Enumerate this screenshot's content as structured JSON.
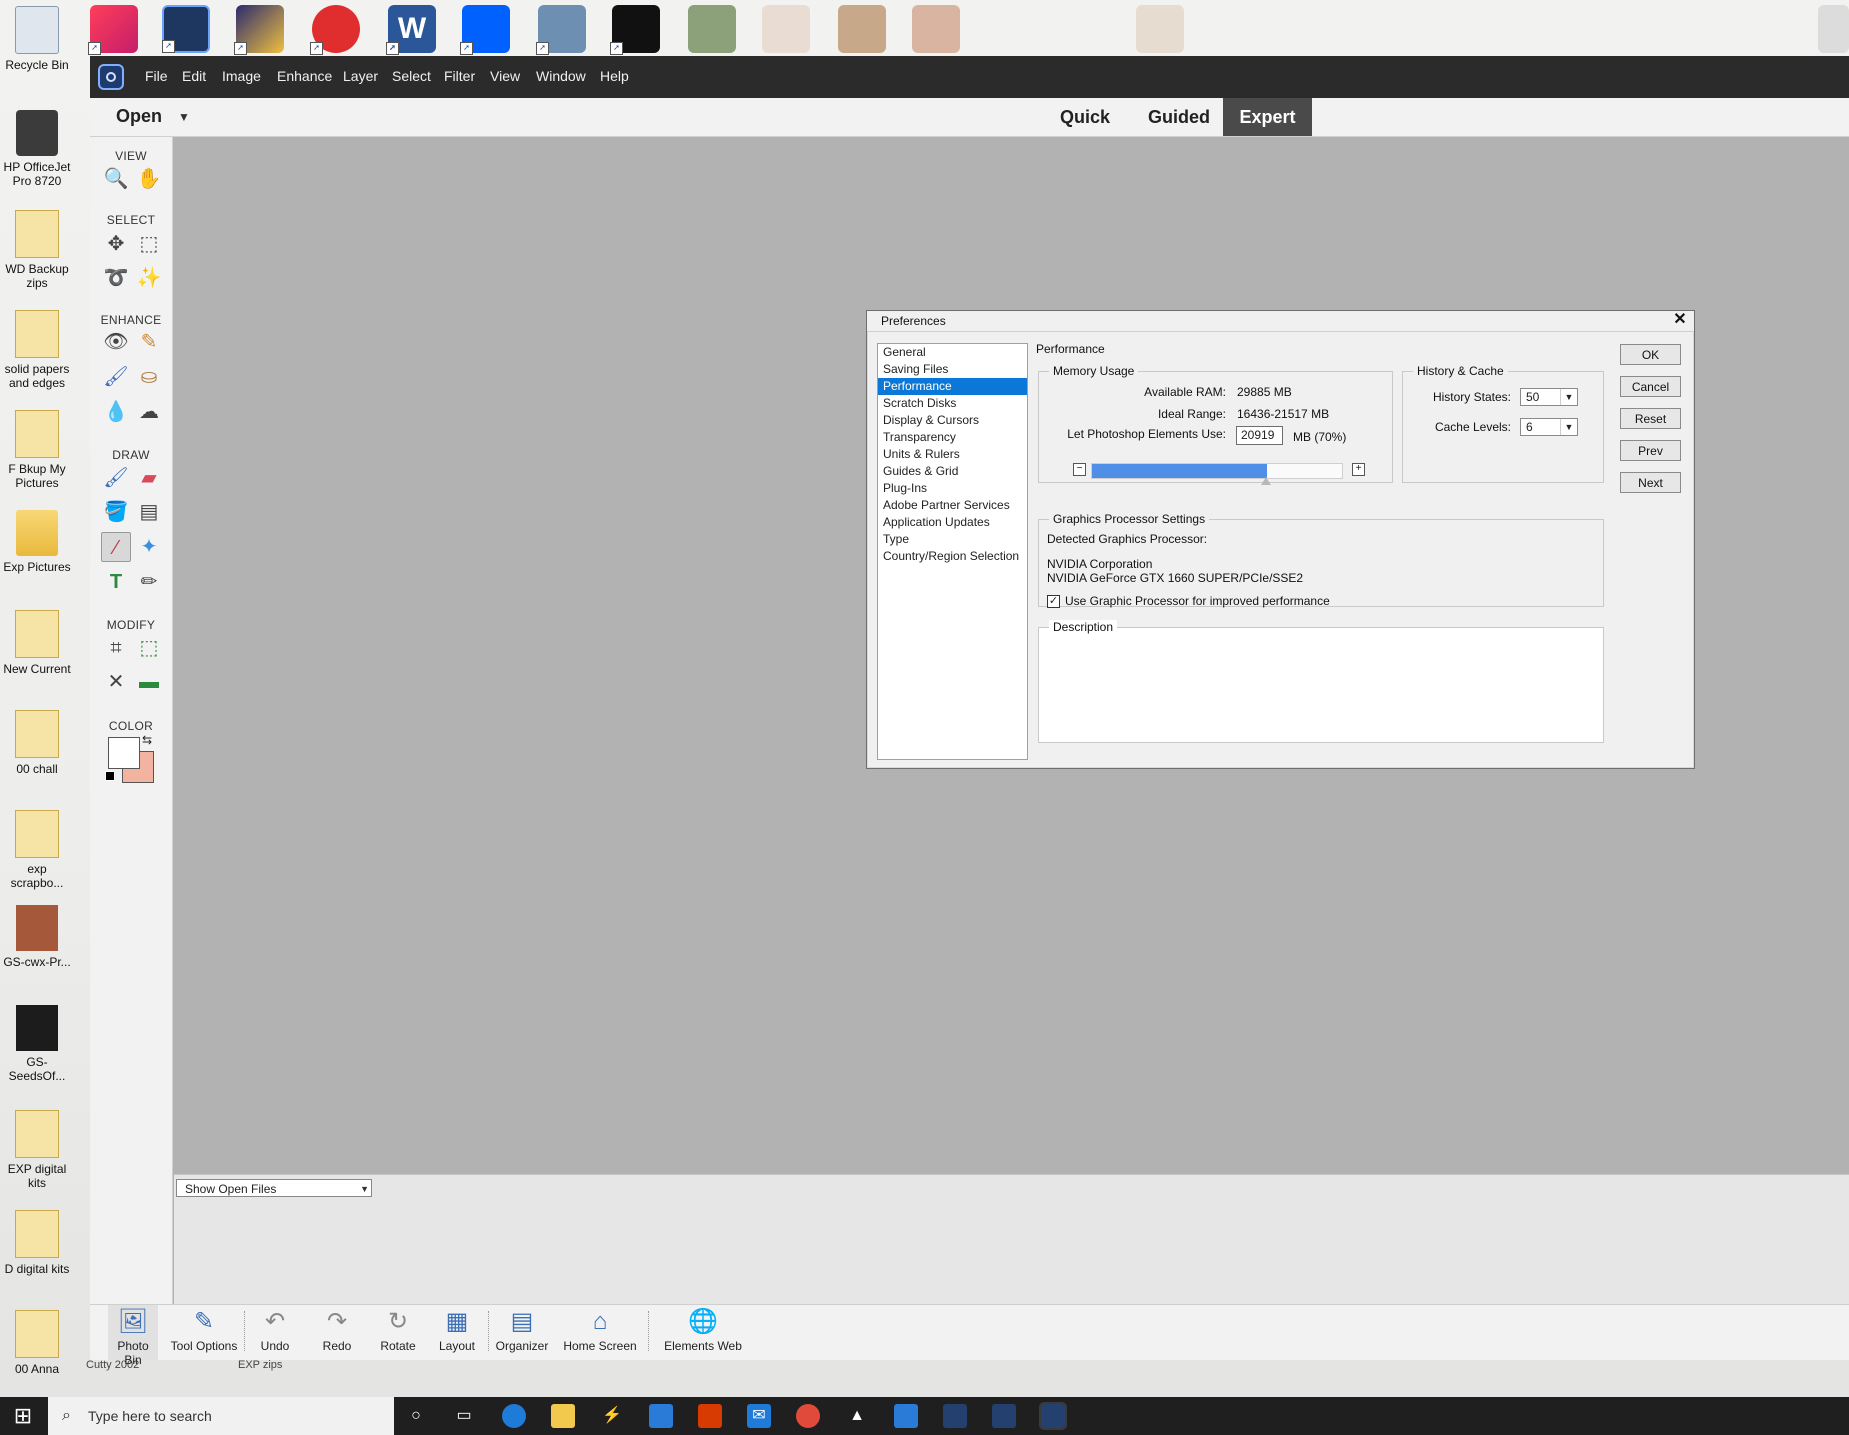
{
  "desktop": {
    "icons": [
      {
        "name": "recycle-bin",
        "label": "Recycle Bin"
      },
      {
        "name": "hp-officejet",
        "label": "HP OfficeJet Pro 8720"
      },
      {
        "name": "wd-backup-zips",
        "label": "WD Backup zips"
      },
      {
        "name": "solid-papers",
        "label": "solid papers and edges"
      },
      {
        "name": "f-bkup-my-pictures",
        "label": "F Bkup My Pictures"
      },
      {
        "name": "exp-pictures",
        "label": "Exp Pictures"
      },
      {
        "name": "new-current",
        "label": "New Current"
      },
      {
        "name": "00-chall",
        "label": "00 chall"
      },
      {
        "name": "exp-scrapbo",
        "label": "exp scrapbo..."
      },
      {
        "name": "gs-cwx-pr",
        "label": "GS-cwx-Pr..."
      },
      {
        "name": "gs-seedsof",
        "label": "GS-SeedsOf..."
      },
      {
        "name": "exp-digital-kits",
        "label": "EXP digital kits"
      },
      {
        "name": "d-digital-kits",
        "label": "D digital kits"
      },
      {
        "name": "00-anna",
        "label": "00 Anna"
      }
    ],
    "partial_labels": [
      "Cutty 2002",
      "EXP zips"
    ]
  },
  "menubar": {
    "items": [
      "File",
      "Edit",
      "Image",
      "Enhance",
      "Layer",
      "Select",
      "Filter",
      "View",
      "Window",
      "Help"
    ]
  },
  "modebar": {
    "open_label": "Open",
    "tabs": [
      "Quick",
      "Guided",
      "Expert"
    ],
    "active_tab": "Expert"
  },
  "toolbox": {
    "sections": [
      "VIEW",
      "SELECT",
      "ENHANCE",
      "DRAW",
      "MODIFY",
      "COLOR"
    ]
  },
  "photo_bin": {
    "show_files_label": "Show Open Files"
  },
  "app_bottom": {
    "items": [
      "Photo Bin",
      "Tool Options",
      "Undo",
      "Redo",
      "Rotate",
      "Layout",
      "Organizer",
      "Home Screen",
      "Elements Web"
    ]
  },
  "preferences": {
    "title": "Preferences",
    "nav": [
      "General",
      "Saving Files",
      "Performance",
      "Scratch Disks",
      "Display & Cursors",
      "Transparency",
      "Units & Rulers",
      "Guides & Grid",
      "Plug-Ins",
      "Adobe Partner Services",
      "Application Updates",
      "Type",
      "Country/Region Selection"
    ],
    "selected_nav": "Performance",
    "section_title": "Performance",
    "memory": {
      "legend": "Memory Usage",
      "available_ram_label": "Available RAM:",
      "available_ram_value": "29885 MB",
      "ideal_range_label": "Ideal Range:",
      "ideal_range_value": "16436-21517 MB",
      "let_use_label": "Let Photoshop Elements Use:",
      "let_use_value": "20919",
      "let_use_unit": "MB (70%)",
      "slider_fraction": 0.7
    },
    "history_cache": {
      "legend": "History & Cache",
      "history_states_label": "History States:",
      "history_states_value": "50",
      "cache_levels_label": "Cache Levels:",
      "cache_levels_value": "6"
    },
    "gpu": {
      "legend": "Graphics Processor Settings",
      "detected_label": "Detected Graphics Processor:",
      "vendor": "NVIDIA Corporation",
      "model": "NVIDIA GeForce GTX 1660 SUPER/PCIe/SSE2",
      "checkbox_label": "Use Graphic Processor for improved performance",
      "checked": true
    },
    "description": {
      "legend": "Description"
    },
    "buttons": [
      "OK",
      "Cancel",
      "Reset",
      "Prev",
      "Next"
    ]
  },
  "taskbar": {
    "search_placeholder": "Type here to search"
  },
  "colors": {
    "accent": "#0b78d7",
    "slider_fill": "#4f8fe8",
    "app_chrome": "#2b2b2b",
    "canvas": "#b2b2b2"
  }
}
